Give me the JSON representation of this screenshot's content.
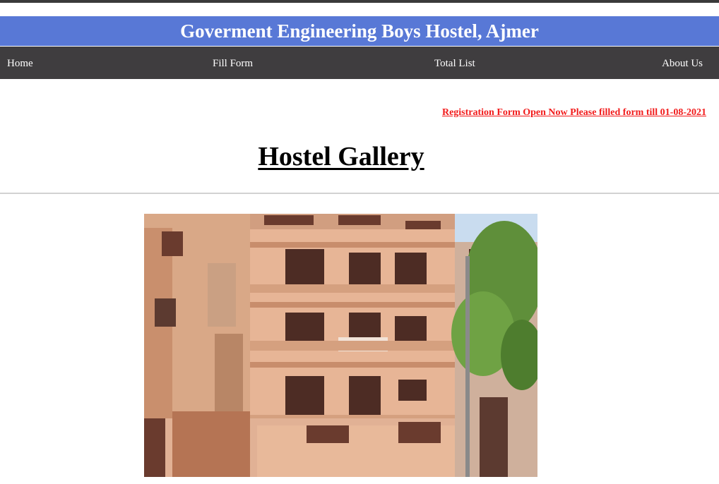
{
  "header": {
    "title": "Goverment Engineering Boys Hostel, Ajmer"
  },
  "nav": {
    "items": [
      {
        "label": "Home"
      },
      {
        "label": "Fill Form"
      },
      {
        "label": "Total List"
      },
      {
        "label": "About Us"
      }
    ]
  },
  "notice": {
    "text": "Registration Form Open Now Please filled form till 01-08-2021"
  },
  "gallery": {
    "title": "Hostel Gallery",
    "photo": "hostel-building-photo"
  },
  "colors": {
    "banner": "#5878d6",
    "navbar": "#3f3d3f",
    "notice": "#f21b1b"
  }
}
